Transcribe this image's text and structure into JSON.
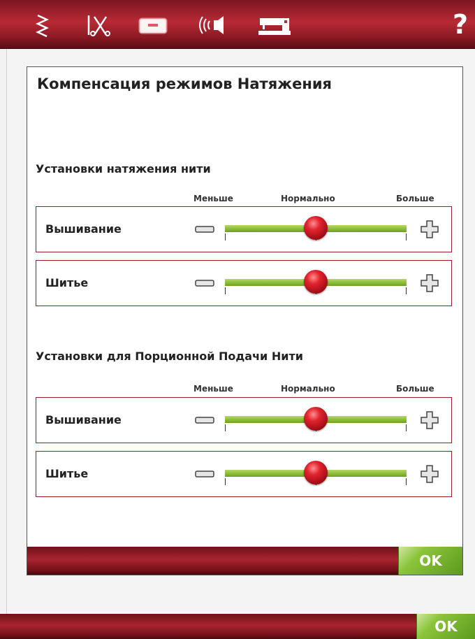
{
  "toolbar": {
    "icons": [
      "stitch-zigzag-icon",
      "needle-scissors-icon",
      "embroidery-hoop-icon",
      "sound-speaker-icon",
      "sewing-machine-icon"
    ],
    "help_label": "?"
  },
  "dialog": {
    "title": "Компенсация режимов Натяжения",
    "ok_label": "OK",
    "sections": [
      {
        "title": "Установки натяжения нити",
        "scale": {
          "less": "Меньше",
          "normal": "Нормально",
          "more": "Больше"
        },
        "rows": [
          {
            "label": "Вышивание",
            "value": 0.5
          },
          {
            "label": "Шитье",
            "value": 0.5
          }
        ]
      },
      {
        "title": "Установки для Порционной Подачи Нити",
        "scale": {
          "less": "Меньше",
          "normal": "Нормально",
          "more": "Больше"
        },
        "rows": [
          {
            "label": "Вышивание",
            "value": 0.5
          },
          {
            "label": "Шитье",
            "value": 0.5
          }
        ]
      }
    ]
  },
  "bottom_bar": {
    "ok_label": "OK"
  },
  "colors": {
    "brand_red": "#a82430",
    "slider_green": "#8fbf3a",
    "knob_red": "#e2242e",
    "ok_green": "#8cc43b"
  }
}
